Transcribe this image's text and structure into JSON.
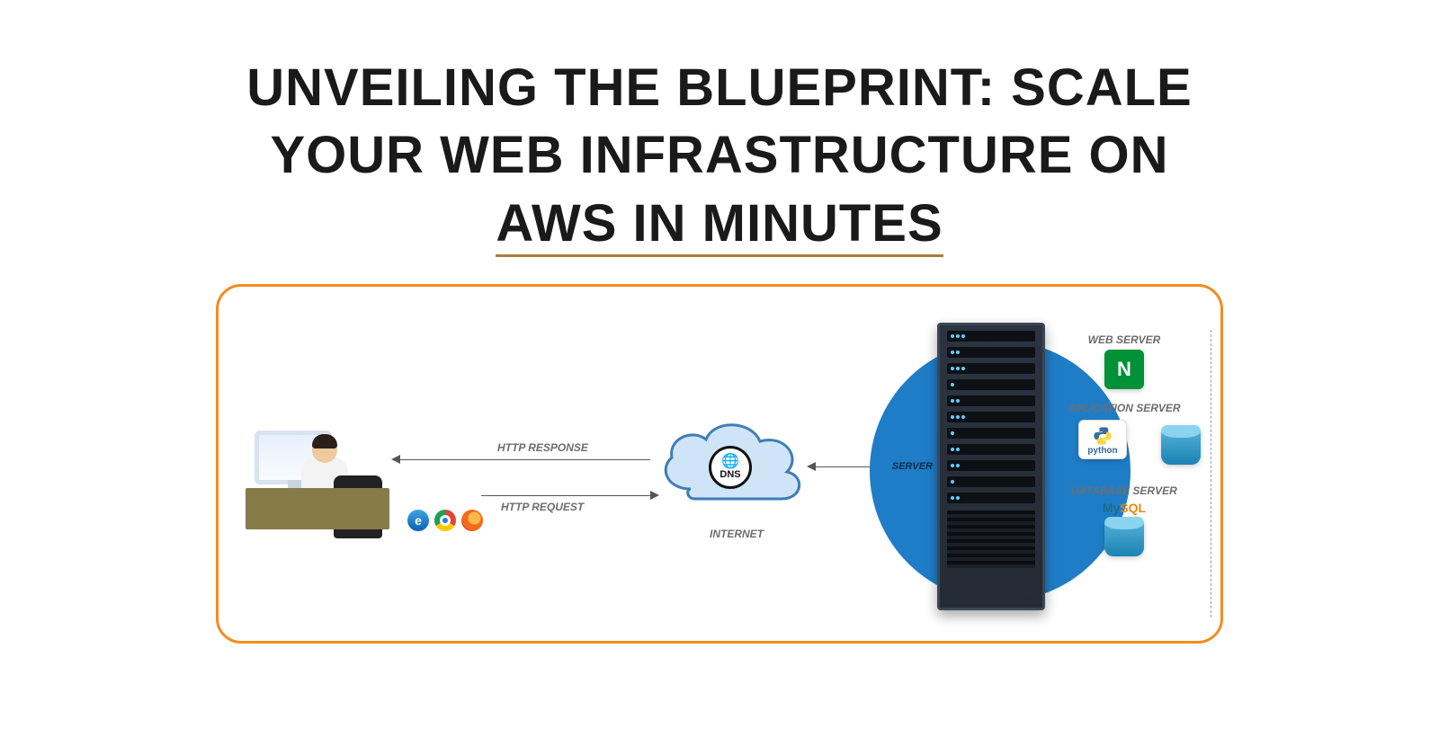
{
  "title": {
    "line1": "UNVEILING THE BLUEPRINT: SCALE",
    "line2": "YOUR WEB INFRASTRUCTURE ON",
    "highlight": "AWS IN MINUTES"
  },
  "labels": {
    "http_response": "HTTP RESPONSE",
    "http_request": "HTTP REQUEST",
    "dns": "DNS",
    "internet": "INTERNET",
    "server": "SERVER",
    "web_server": "WEB SERVER",
    "app_server": "APLICATION SERVER",
    "db_server": "DATABASE SERVER",
    "python": "python",
    "mysql_my": "My",
    "mysql_sql": "SQL"
  },
  "browsers": [
    "internet-explorer",
    "chrome",
    "firefox"
  ],
  "stack": {
    "web": "nginx",
    "app": [
      "python",
      "database"
    ],
    "db": "mysql"
  }
}
